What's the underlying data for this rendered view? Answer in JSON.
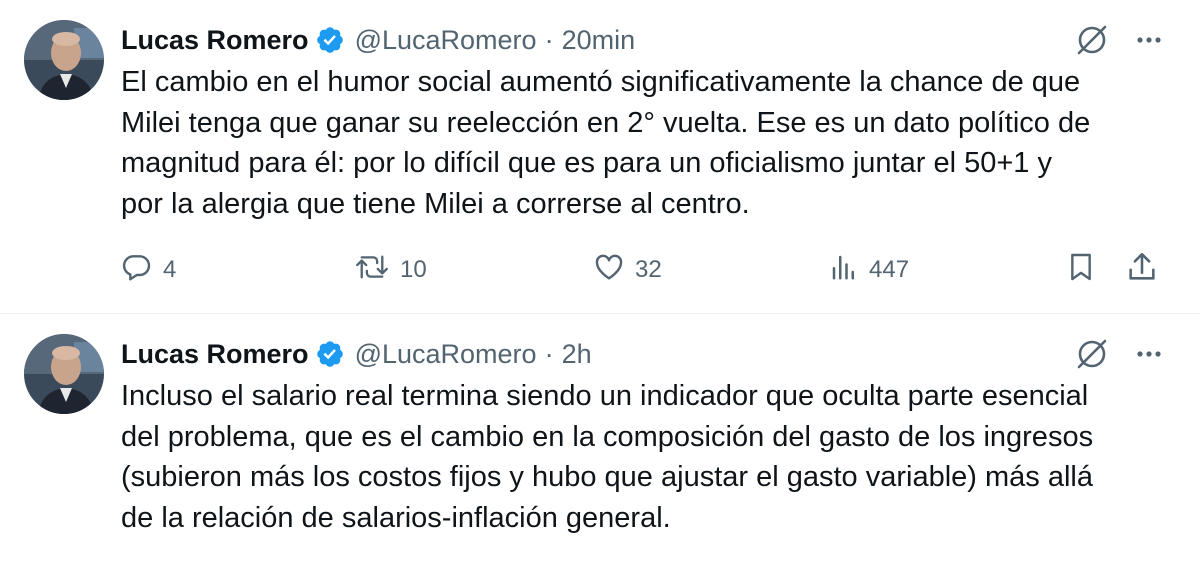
{
  "tweets": [
    {
      "author": {
        "name": "Lucas Romero",
        "handle": "@LucaRomero",
        "verified": true,
        "avatar": "avatar-photo"
      },
      "separator": "·",
      "time": "20min",
      "text": "El cambio en el humor social aumentó significativamente la chance de que\nMilei tenga que ganar su reelección en 2° vuelta. Ese es un dato político de\nmagnitud para él: por lo difícil que es para un oficialismo juntar el 50+1 y\npor la alergia que tiene Milei a correrse al centro.",
      "stats": {
        "replies": "4",
        "retweets": "10",
        "likes": "32",
        "views": "447"
      }
    },
    {
      "author": {
        "name": "Lucas Romero",
        "handle": "@LucaRomero",
        "verified": true,
        "avatar": "avatar-photo"
      },
      "separator": "·",
      "time": "2h",
      "text": "Incluso el salario real termina siendo un indicador que oculta parte esencial\ndel problema, que es el cambio en la composición del gasto de los ingresos\n(subieron más los costos fijos y hubo que ajustar el gasto variable) más allá\nde la relación de salarios-inflación general."
    }
  ],
  "icons": {
    "grok": "grok-icon",
    "more": "more-icon",
    "reply": "reply-icon",
    "retweet": "retweet-icon",
    "like": "heart-icon",
    "views": "views-icon",
    "bookmark": "bookmark-icon",
    "share": "share-icon",
    "verified": "verified-badge-icon"
  },
  "colors": {
    "text": "#0f1419",
    "secondary": "#536471",
    "verified": "#1d9bf0",
    "divider": "#eff3f4"
  }
}
